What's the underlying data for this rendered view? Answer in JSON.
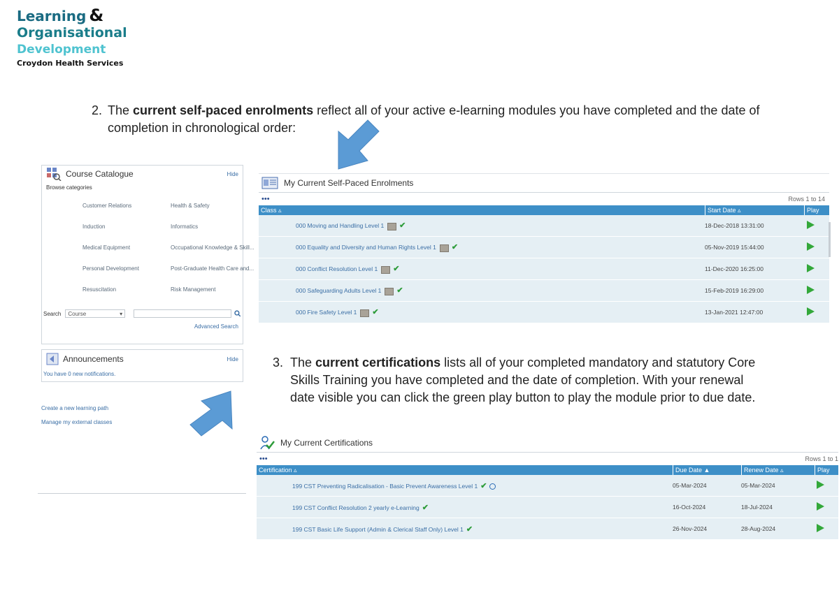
{
  "logo": {
    "line1": "Learning",
    "amp": "&",
    "line2": "Organisational",
    "line3": "Development",
    "line4": "Croydon Health Services"
  },
  "step2": {
    "number": "2.",
    "prefix": "The ",
    "bold": "current self-paced enrolments",
    "suffix": " reflect all of your active e-learning modules you have completed and the date of completion in chronological order:"
  },
  "step3": {
    "number": "3.",
    "prefix": "The ",
    "bold": "current certifications",
    "suffix": " lists all of your completed mandatory and statutory Core Skills Training you have completed and the date of completion.  With your renewal date visible you can click the green play button to play the module prior to due date."
  },
  "catalogue": {
    "title": "Course Catalogue",
    "hide": "Hide",
    "browse": "Browse categories",
    "categories": [
      [
        "Customer Relations",
        "Health & Safety"
      ],
      [
        "Induction",
        "Informatics"
      ],
      [
        "Medical Equipment",
        "Occupational Knowledge & Skill..."
      ],
      [
        "Personal Development",
        "Post-Graduate Health Care and..."
      ],
      [
        "Resuscitation",
        "Risk Management"
      ]
    ],
    "search_label": "Search",
    "search_select": "Course",
    "advanced": "Advanced Search"
  },
  "announcements": {
    "title": "Announcements",
    "hide": "Hide",
    "text": "You have 0 new notifications."
  },
  "side_links": {
    "path": "Create a new learning path",
    "external": "Manage my external classes"
  },
  "enrolments": {
    "title": "My Current Self-Paced Enrolments",
    "dots": "•••",
    "rows_count": "Rows 1 to 14",
    "headers": {
      "class": "Class",
      "start": "Start Date",
      "play": "Play"
    },
    "rows": [
      {
        "name": "000 Moving and Handling Level 1",
        "date": "18-Dec-2018 13:31:00"
      },
      {
        "name": "000 Equality and Diversity and Human Rights Level 1",
        "date": "05-Nov-2019 15:44:00"
      },
      {
        "name": "000 Conflict Resolution Level 1",
        "date": "11-Dec-2020 16:25:00"
      },
      {
        "name": "000 Safeguarding Adults Level 1",
        "date": "15-Feb-2019 16:29:00"
      },
      {
        "name": "000 Fire Safety Level 1",
        "date": "13-Jan-2021 12:47:00"
      }
    ]
  },
  "certifications": {
    "title": "My Current Certifications",
    "dots": "•••",
    "rows_count": "Rows 1 to 1",
    "headers": {
      "cert": "Certification",
      "due": "Due Date",
      "renew": "Renew Date",
      "play": "Play"
    },
    "rows": [
      {
        "name": "199 CST Preventing Radicalisation - Basic Prevent Awareness Level 1",
        "due": "05-Mar-2024",
        "renew": "05-Mar-2024"
      },
      {
        "name": "199 CST Conflict Resolution 2 yearly e-Learning",
        "due": "16-Oct-2024",
        "renew": "18-Jul-2024"
      },
      {
        "name": "199 CST Basic Life Support (Admin & Clerical Staff Only) Level 1",
        "due": "26-Nov-2024",
        "renew": "28-Aug-2024"
      }
    ]
  },
  "colors": {
    "arrow": "#5b9bd5",
    "header": "#3d8fc7",
    "row": "#e5eff4",
    "play": "#33a83a"
  }
}
